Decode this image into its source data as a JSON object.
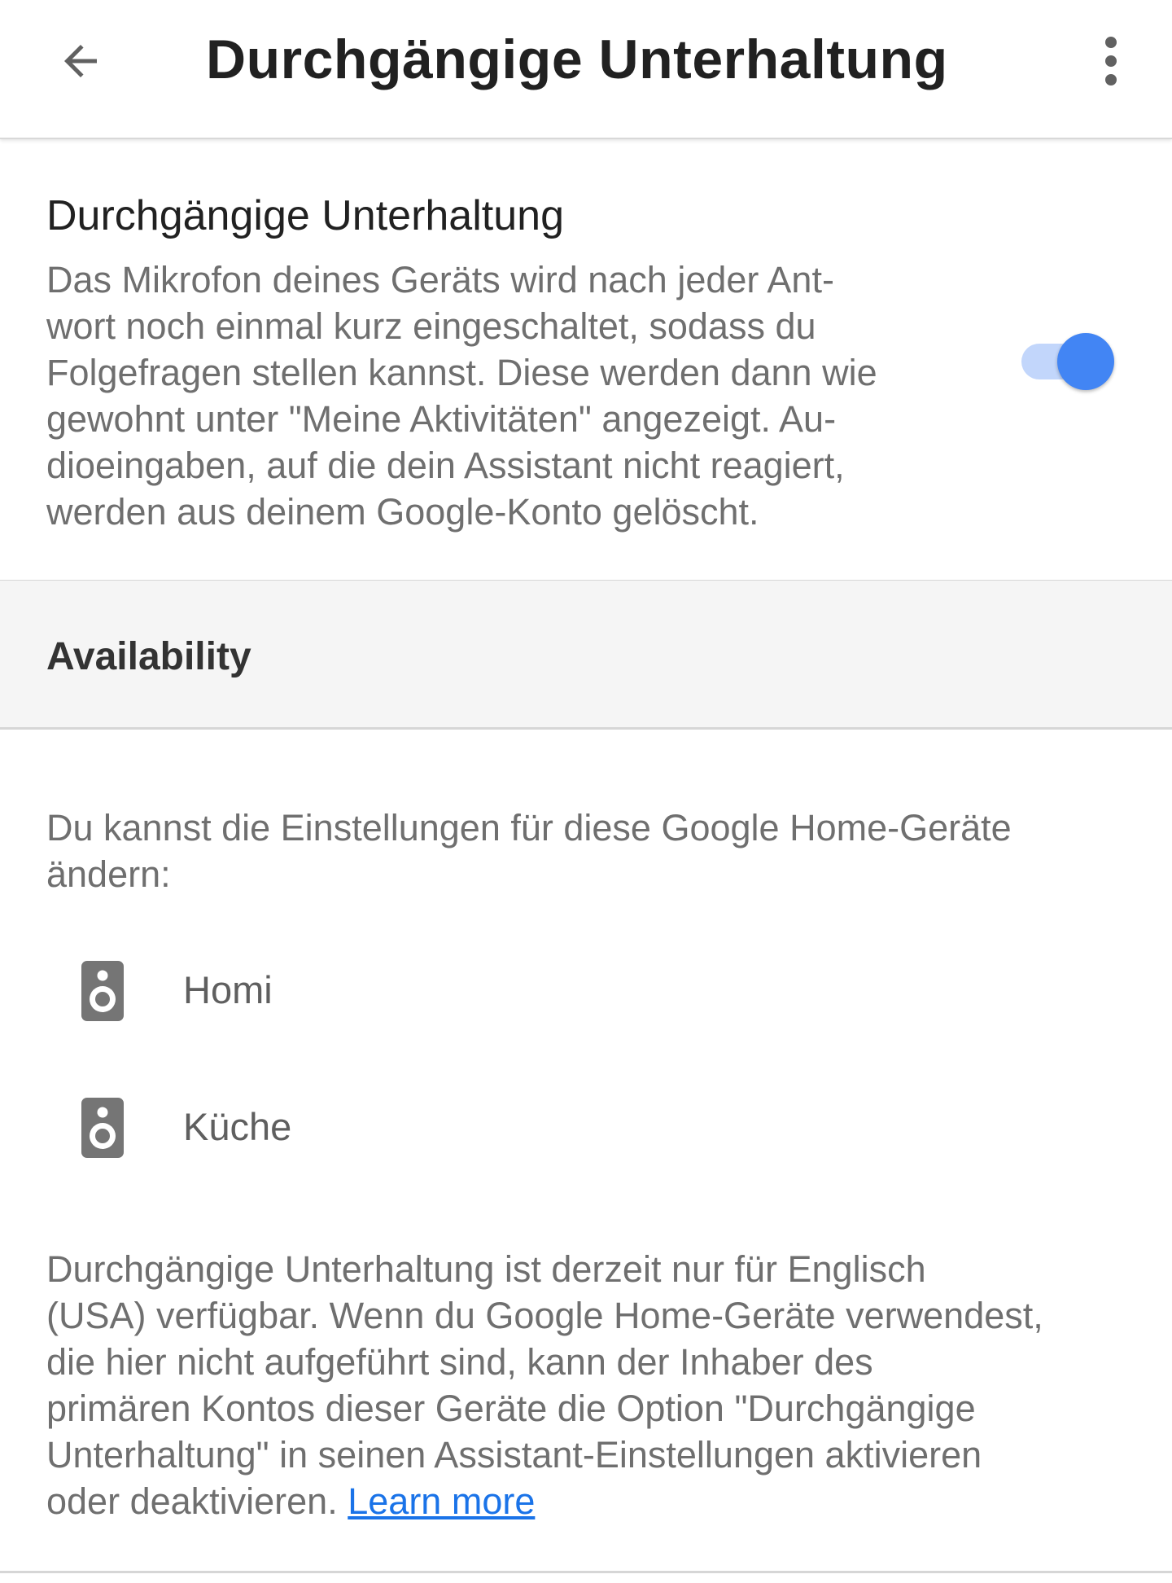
{
  "appbar": {
    "title": "Durchgängige Unterhaltung"
  },
  "setting": {
    "title": "Durchgängige Unterhaltung",
    "description_lines": [
      "Das Mikrofon deines Geräts wird nach jeder Ant-",
      "wort noch einmal kurz eingeschaltet, sodass du",
      "Folgefragen stellen kannst. Diese werden dann wie",
      "gewohnt unter \"Meine Aktivitäten\" angezeigt. Au-",
      "dioeingaben, auf die dein Assistant nicht reagiert,",
      "werden aus deinem Google-Konto gelöscht."
    ],
    "toggle_on": true,
    "accent_color": "#4285f4"
  },
  "availability": {
    "header": "Availability",
    "intro_lines": [
      "Du kannst die Einstellungen für diese Google Home-Geräte",
      "ändern:"
    ],
    "devices": [
      {
        "name": "Homi",
        "icon": "speaker-icon"
      },
      {
        "name": "Küche",
        "icon": "speaker-icon"
      }
    ],
    "footer_lines": [
      "Durchgängige Unterhaltung ist derzeit nur für Englisch",
      "(USA) verfügbar. Wenn du Google Home-Geräte verwendest,",
      "die hier nicht aufgeführt sind, kann der Inhaber des",
      "primären Kontos dieser Geräte die Option \"Durchgängige",
      "Unterhaltung\" in seinen Assistant-Einstellungen aktivieren"
    ],
    "footer_last_line": "oder deaktivieren.",
    "learn_more": "Learn more",
    "link_color": "#1a73e8"
  }
}
